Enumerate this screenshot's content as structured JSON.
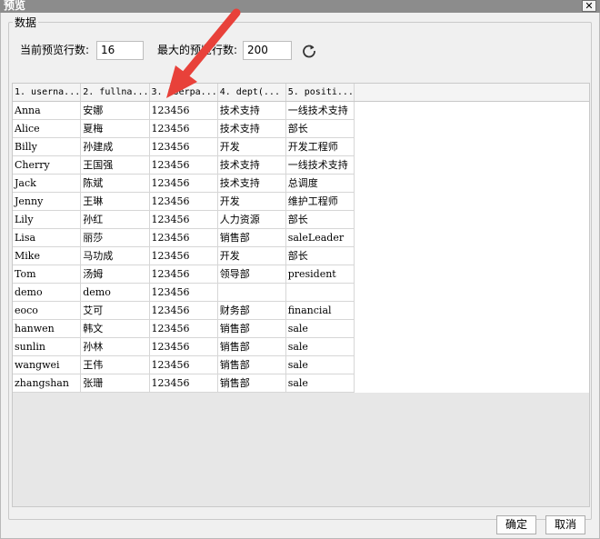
{
  "window": {
    "title": "预览",
    "close_glyph": "✕"
  },
  "group": {
    "label": "数据"
  },
  "controls": {
    "current_rows_label": "当前预览行数:",
    "current_rows_value": "16",
    "max_rows_label": "最大的预览行数:",
    "max_rows_value": "200",
    "refresh_icon": "refresh-icon"
  },
  "grid": {
    "columns": [
      "1. userna...",
      "2. fullna...",
      "3. userpa...",
      "4. dept(...",
      "5. positi..."
    ],
    "rows": [
      [
        "Anna",
        "安娜",
        "123456",
        "技术支持",
        "一线技术支持"
      ],
      [
        "Alice",
        "夏梅",
        "123456",
        "技术支持",
        "部长"
      ],
      [
        "Billy",
        "孙建成",
        "123456",
        "开发",
        "开发工程师"
      ],
      [
        "Cherry",
        "王国强",
        "123456",
        "技术支持",
        "一线技术支持"
      ],
      [
        "Jack",
        "陈斌",
        "123456",
        "技术支持",
        "总调度"
      ],
      [
        "Jenny",
        "王琳",
        "123456",
        "开发",
        "维护工程师"
      ],
      [
        "Lily",
        "孙红",
        "123456",
        "人力资源",
        "部长"
      ],
      [
        "Lisa",
        "丽莎",
        "123456",
        "销售部",
        "saleLeader"
      ],
      [
        "Mike",
        "马功成",
        "123456",
        "开发",
        "部长"
      ],
      [
        "Tom",
        "汤姆",
        "123456",
        "领导部",
        "president"
      ],
      [
        "demo",
        "demo",
        "123456",
        "",
        ""
      ],
      [
        "eoco",
        "艾可",
        "123456",
        "财务部",
        "financial"
      ],
      [
        "hanwen",
        "韩文",
        "123456",
        "销售部",
        "sale"
      ],
      [
        "sunlin",
        "孙林",
        "123456",
        "销售部",
        "sale"
      ],
      [
        "wangwei",
        "王伟",
        "123456",
        "销售部",
        "sale"
      ],
      [
        "zhangshan",
        "张珊",
        "123456",
        "销售部",
        "sale"
      ]
    ]
  },
  "buttons": {
    "ok": "确定",
    "cancel": "取消"
  },
  "annotation": {
    "arrow_color": "#e8413a"
  }
}
